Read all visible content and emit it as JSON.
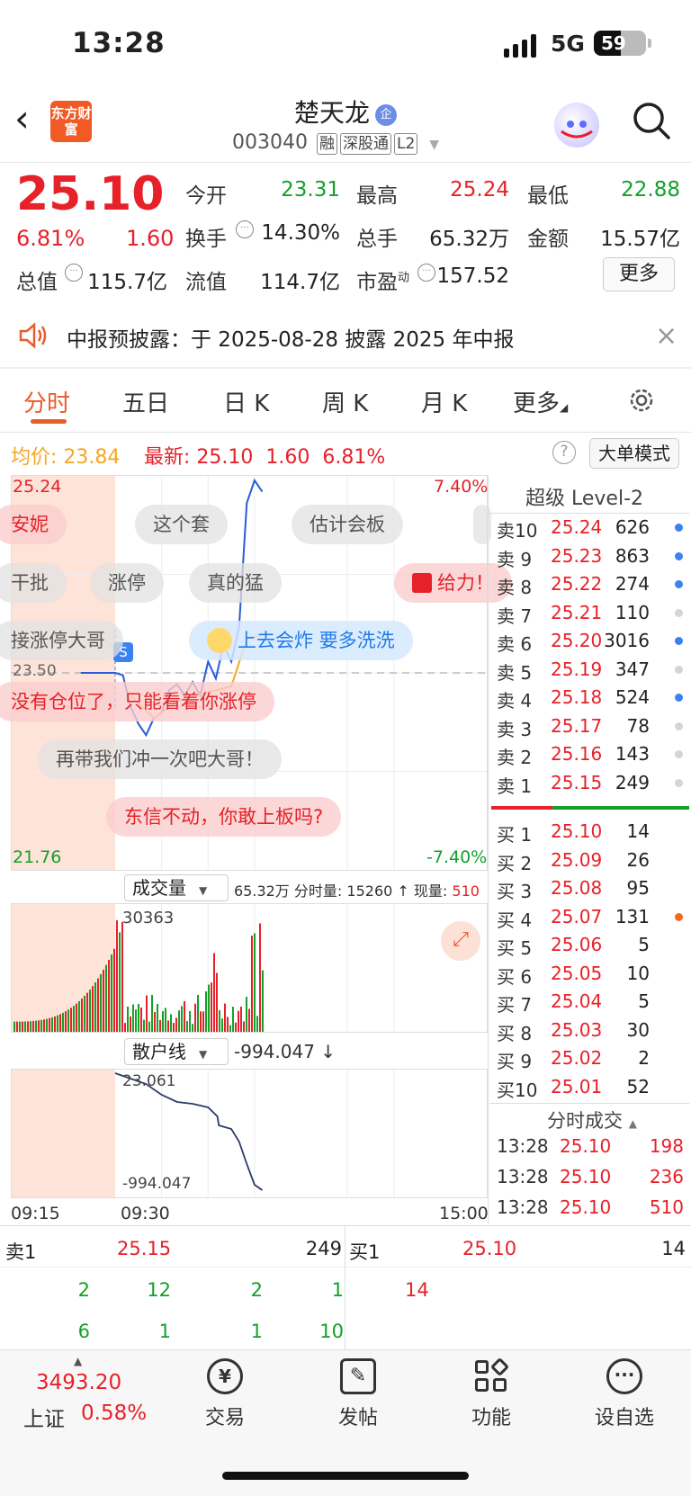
{
  "status_bar": {
    "time": "13:28",
    "network": "5G",
    "battery": "59"
  },
  "header": {
    "logo_text": "东方财富",
    "stock_name": "楚天龙",
    "qi_badge": "企",
    "code": "003040",
    "tags": [
      "融",
      "深股通",
      "L2"
    ]
  },
  "quote": {
    "price": "25.10",
    "change_pct": "6.81%",
    "change": "1.60",
    "rows": [
      [
        {
          "k": "今开",
          "v": "23.31",
          "c": "green"
        },
        {
          "k": "最高",
          "v": "25.24",
          "c": "red"
        },
        {
          "k": "最低",
          "v": "22.88",
          "c": "green"
        }
      ],
      [
        {
          "k": "换手",
          "v": "14.30%",
          "c": "dark"
        },
        {
          "k": "总手",
          "v": "65.32万",
          "c": "dark"
        },
        {
          "k": "金额",
          "v": "15.57亿",
          "c": "dark"
        }
      ],
      [
        {
          "k": "总值",
          "v": "115.7亿",
          "c": "dark"
        },
        {
          "k": "流值",
          "v": "114.7亿",
          "c": "dark"
        },
        {
          "k": "市盈",
          "sup": "动",
          "v": "157.52",
          "c": "dark"
        }
      ]
    ],
    "more_label": "更多"
  },
  "notice": {
    "text": "中报预披露：于 2025-08-28 披露 2025 年中报",
    "close": "×"
  },
  "tabs": [
    "分时",
    "五日",
    "日 K",
    "周 K",
    "月 K",
    "更多"
  ],
  "info_line": {
    "avg_label": "均价:",
    "avg": "23.84",
    "last_label": "最新:",
    "last": "25.10",
    "chg": "1.60",
    "pct": "6.81%",
    "mode_label": "大单模式",
    "help": "?"
  },
  "chart_data": [
    {
      "type": "line",
      "title": "分时",
      "x_range": [
        "09:15",
        "15:00"
      ],
      "ylim": [
        21.76,
        25.24
      ],
      "pct_range": [
        "7.40%",
        "-7.40%"
      ],
      "prev_close": 23.5,
      "series": [
        {
          "name": "价格",
          "color": "#2a5bd7",
          "points": [
            [
              9.25,
              23.5
            ],
            [
              9.3,
              23.5
            ],
            [
              9.35,
              23.48
            ],
            [
              9.4,
              23.2
            ],
            [
              9.45,
              23.05
            ],
            [
              9.5,
              22.95
            ],
            [
              9.55,
              23.1
            ],
            [
              10.0,
              23.15
            ],
            [
              10.05,
              23.35
            ],
            [
              10.1,
              23.4
            ],
            [
              10.15,
              23.3
            ],
            [
              10.2,
              23.42
            ],
            [
              10.25,
              23.3
            ],
            [
              10.3,
              23.6
            ],
            [
              10.35,
              23.45
            ],
            [
              10.4,
              23.75
            ],
            [
              10.45,
              23.6
            ],
            [
              10.5,
              23.9
            ],
            [
              10.55,
              25.0
            ],
            [
              11.0,
              25.2
            ],
            [
              11.05,
              25.1
            ]
          ]
        },
        {
          "name": "均价",
          "color": "#f6a623",
          "points": [
            [
              9.4,
              23.3
            ],
            [
              9.55,
              23.1
            ],
            [
              10.1,
              23.25
            ],
            [
              10.3,
              23.33
            ],
            [
              10.45,
              23.38
            ],
            [
              10.55,
              23.8
            ],
            [
              11.05,
              23.84
            ]
          ]
        }
      ]
    },
    {
      "type": "bar",
      "title": "成交量",
      "total": "65.32万",
      "interval_vol_label": "分时量:",
      "interval_vol": "15260",
      "now_vol_label": "现量:",
      "now_vol": "510",
      "max_label": "30363"
    },
    {
      "type": "line",
      "title": "散户线",
      "value": "-994.047",
      "ylim": [
        -994.047,
        23.061
      ],
      "labels": [
        "23.061",
        "-994.047"
      ]
    }
  ],
  "axis": {
    "t_start": "09:15",
    "t_open": "09:30",
    "t_end": "15:00",
    "pct_hi": "7.40%",
    "pct_lo": "-7.40%",
    "y_hi": "25.24",
    "y_lo": "21.76",
    "prev_close": "23.50"
  },
  "bubbles": [
    {
      "t": "安妮",
      "c": "red"
    },
    {
      "t": "这个套",
      "c": "gray"
    },
    {
      "t": "估计会板",
      "c": "gray"
    },
    {
      "t": "干批",
      "c": "gray"
    },
    {
      "t": "涨停",
      "c": "gray"
    },
    {
      "t": "真的猛",
      "c": "gray"
    },
    {
      "t": "给力！",
      "c": "red"
    },
    {
      "t": "接涨停大哥",
      "c": "gray"
    },
    {
      "t": "上去会炸 要多洗洗",
      "c": "blue"
    },
    {
      "t": "没有仓位了，只能看着你涨停",
      "c": "red"
    },
    {
      "t": "再带我们冲一次吧大哥！",
      "c": "gray"
    },
    {
      "t": "东信不动，你敢上板吗?",
      "c": "red"
    }
  ],
  "orderbook": {
    "title": "超级 Level-2",
    "asks": [
      {
        "l": "卖10",
        "p": "25.24",
        "v": "626",
        "d": "blue"
      },
      {
        "l": "卖 9",
        "p": "25.23",
        "v": "863",
        "d": "blue"
      },
      {
        "l": "卖 8",
        "p": "25.22",
        "v": "274",
        "d": "blue"
      },
      {
        "l": "卖 7",
        "p": "25.21",
        "v": "110",
        "d": "gray"
      },
      {
        "l": "卖 6",
        "p": "25.20",
        "v": "3016",
        "d": "blue"
      },
      {
        "l": "卖 5",
        "p": "25.19",
        "v": "347",
        "d": "gray"
      },
      {
        "l": "卖 4",
        "p": "25.18",
        "v": "524",
        "d": "blue"
      },
      {
        "l": "卖 3",
        "p": "25.17",
        "v": "78",
        "d": "gray"
      },
      {
        "l": "卖 2",
        "p": "25.16",
        "v": "143",
        "d": "gray"
      },
      {
        "l": "卖 1",
        "p": "25.15",
        "v": "249",
        "d": "gray"
      }
    ],
    "bids": [
      {
        "l": "买 1",
        "p": "25.10",
        "v": "14",
        "d": ""
      },
      {
        "l": "买 2",
        "p": "25.09",
        "v": "26",
        "d": ""
      },
      {
        "l": "买 3",
        "p": "25.08",
        "v": "95",
        "d": ""
      },
      {
        "l": "买 4",
        "p": "25.07",
        "v": "131",
        "d": "orange"
      },
      {
        "l": "买 5",
        "p": "25.06",
        "v": "5",
        "d": ""
      },
      {
        "l": "买 6",
        "p": "25.05",
        "v": "10",
        "d": ""
      },
      {
        "l": "买 7",
        "p": "25.04",
        "v": "5",
        "d": ""
      },
      {
        "l": "买 8",
        "p": "25.03",
        "v": "30",
        "d": ""
      },
      {
        "l": "买 9",
        "p": "25.02",
        "v": "2",
        "d": ""
      },
      {
        "l": "买10",
        "p": "25.01",
        "v": "52",
        "d": ""
      }
    ],
    "trades_title": "分时成交",
    "trades": [
      {
        "t": "13:28",
        "p": "25.10",
        "v": "198"
      },
      {
        "t": "13:28",
        "p": "25.10",
        "v": "236"
      },
      {
        "t": "13:28",
        "p": "25.10",
        "v": "510"
      }
    ]
  },
  "queue": {
    "sell_label": "卖1",
    "sell_price": "25.15",
    "sell_vol": "249",
    "buy_label": "买1",
    "buy_price": "25.10",
    "buy_vol": "14",
    "sell_orders": [
      [
        "2",
        "12",
        "2",
        "1"
      ],
      [
        "6",
        "1",
        "1",
        "10"
      ]
    ],
    "buy_orders": [
      "14"
    ]
  },
  "bottom_nav": {
    "index_value": "3493.20",
    "index_name": "上证",
    "index_pct": "0.58%",
    "items": [
      "交易",
      "发帖",
      "功能",
      "设自选"
    ]
  },
  "colors": {
    "up": "#e62129",
    "down": "#13a129",
    "accent": "#e85d2a",
    "price_line": "#2a5bd7",
    "avg_line": "#f6a623"
  }
}
